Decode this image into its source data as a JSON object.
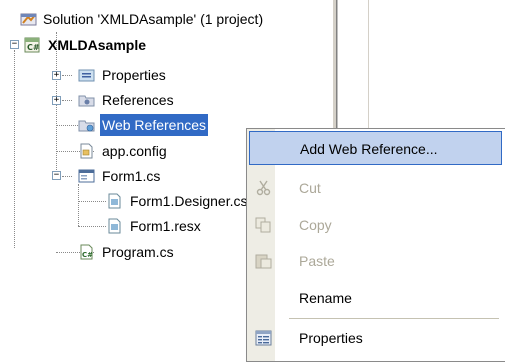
{
  "tree": {
    "solution_label": "Solution 'XMLDAsample' (1 project)",
    "project_label": "XMLDAsample",
    "items": [
      {
        "label": "Properties"
      },
      {
        "label": "References"
      },
      {
        "label": "Web References"
      },
      {
        "label": "app.config"
      },
      {
        "label": "Form1.cs"
      },
      {
        "label": "Form1.Designer.cs"
      },
      {
        "label": "Form1.resx"
      },
      {
        "label": "Program.cs"
      }
    ],
    "expand_plus": "+",
    "expand_minus": "−",
    "selected_item": "Web References"
  },
  "context_menu": {
    "items": [
      {
        "label": "Add Web Reference...",
        "enabled": true,
        "highlighted": true
      },
      {
        "label": "Cut",
        "enabled": false
      },
      {
        "label": "Copy",
        "enabled": false
      },
      {
        "label": "Paste",
        "enabled": false
      },
      {
        "label": "Rename",
        "enabled": true
      },
      {
        "label": "Properties",
        "enabled": true
      }
    ]
  },
  "colors": {
    "selection": "#316ac5",
    "menu_highlight": "#c1d2ee",
    "disabled_text": "#aca899"
  }
}
